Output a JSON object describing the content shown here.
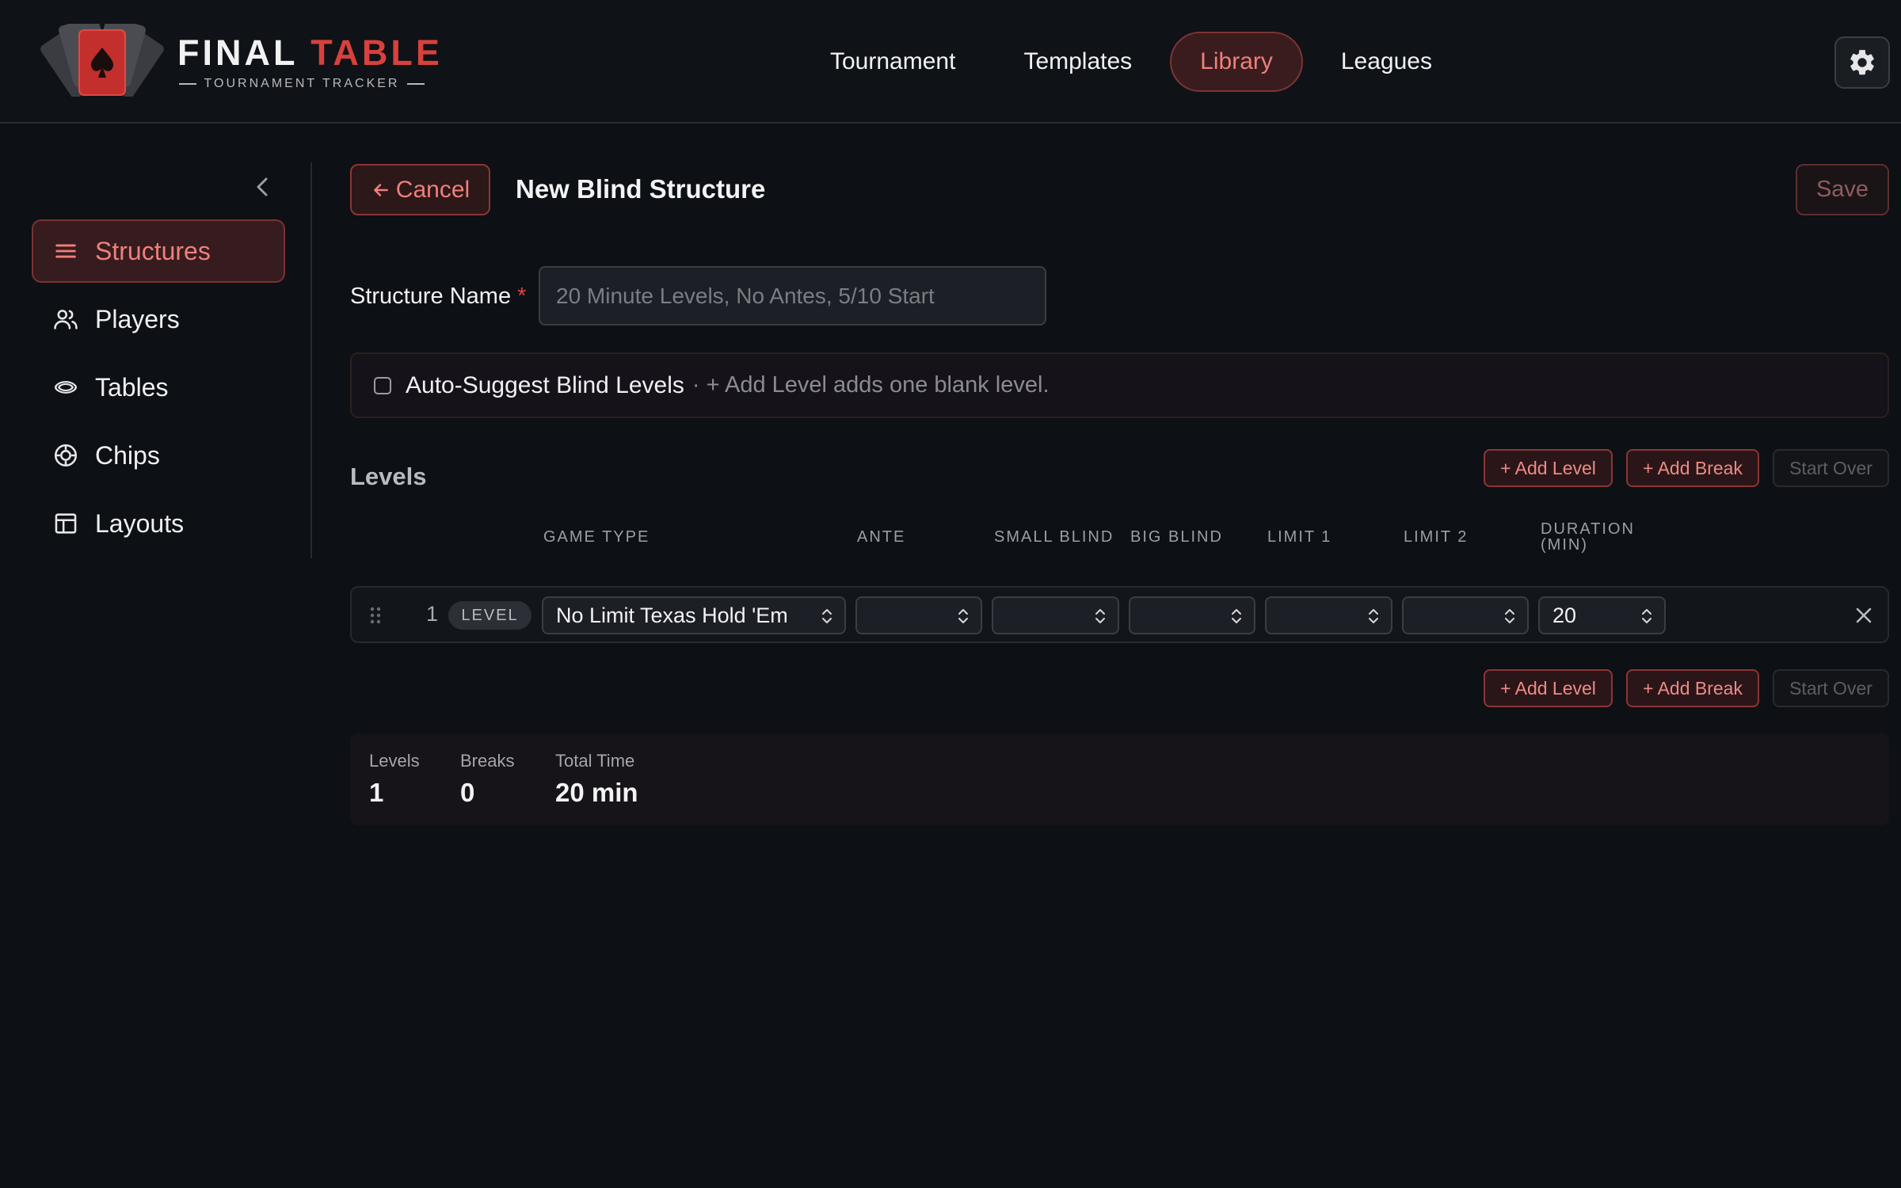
{
  "app": {
    "logo_word1": "FINAL",
    "logo_word2": "TABLE",
    "logo_subtitle": "TOURNAMENT TRACKER",
    "accent": "#d8413c"
  },
  "nav": {
    "items": [
      {
        "label": "Tournament",
        "active": false
      },
      {
        "label": "Templates",
        "active": false
      },
      {
        "label": "Library",
        "active": true
      },
      {
        "label": "Leagues",
        "active": false
      }
    ],
    "settings_icon": "gear-icon"
  },
  "sidebar": {
    "collapse_icon": "chevron-left-icon",
    "items": [
      {
        "label": "Structures",
        "icon": "list-icon",
        "active": true
      },
      {
        "label": "Players",
        "icon": "users-icon",
        "active": false
      },
      {
        "label": "Tables",
        "icon": "table-oval-icon",
        "active": false
      },
      {
        "label": "Chips",
        "icon": "chip-icon",
        "active": false
      },
      {
        "label": "Layouts",
        "icon": "layout-icon",
        "active": false
      }
    ]
  },
  "toolbar": {
    "cancel_label": "Cancel",
    "title": "New Blind Structure",
    "save_label": "Save"
  },
  "form": {
    "name_label": "Structure Name",
    "required_mark": "*",
    "name_placeholder": "20 Minute Levels, No Antes, 5/10 Start",
    "name_value": "",
    "auto_suggest_label": "Auto-Suggest Blind Levels",
    "auto_suggest_hint": "· + Add Level adds one blank level.",
    "auto_suggest_checked": false
  },
  "levels": {
    "title": "Levels",
    "add_level_label": "+ Add Level",
    "add_break_label": "+ Add Break",
    "start_over_label": "Start Over",
    "columns": {
      "game_type": "GAME TYPE",
      "ante": "ANTE",
      "small_blind": "SMALL BLIND",
      "big_blind": "BIG BLIND",
      "limit1": "LIMIT 1",
      "limit2": "LIMIT 2",
      "duration_line1": "DURATION",
      "duration_line2": "(MIN)"
    },
    "rows": [
      {
        "number": "1",
        "badge": "LEVEL",
        "game_type": "No Limit Texas Hold 'Em",
        "ante": "",
        "small_blind": "",
        "big_blind": "",
        "limit1": "",
        "limit2": "",
        "duration": "20"
      }
    ]
  },
  "summary": {
    "levels_label": "Levels",
    "levels_value": "1",
    "breaks_label": "Breaks",
    "breaks_value": "0",
    "total_label": "Total Time",
    "total_value": "20 min"
  }
}
